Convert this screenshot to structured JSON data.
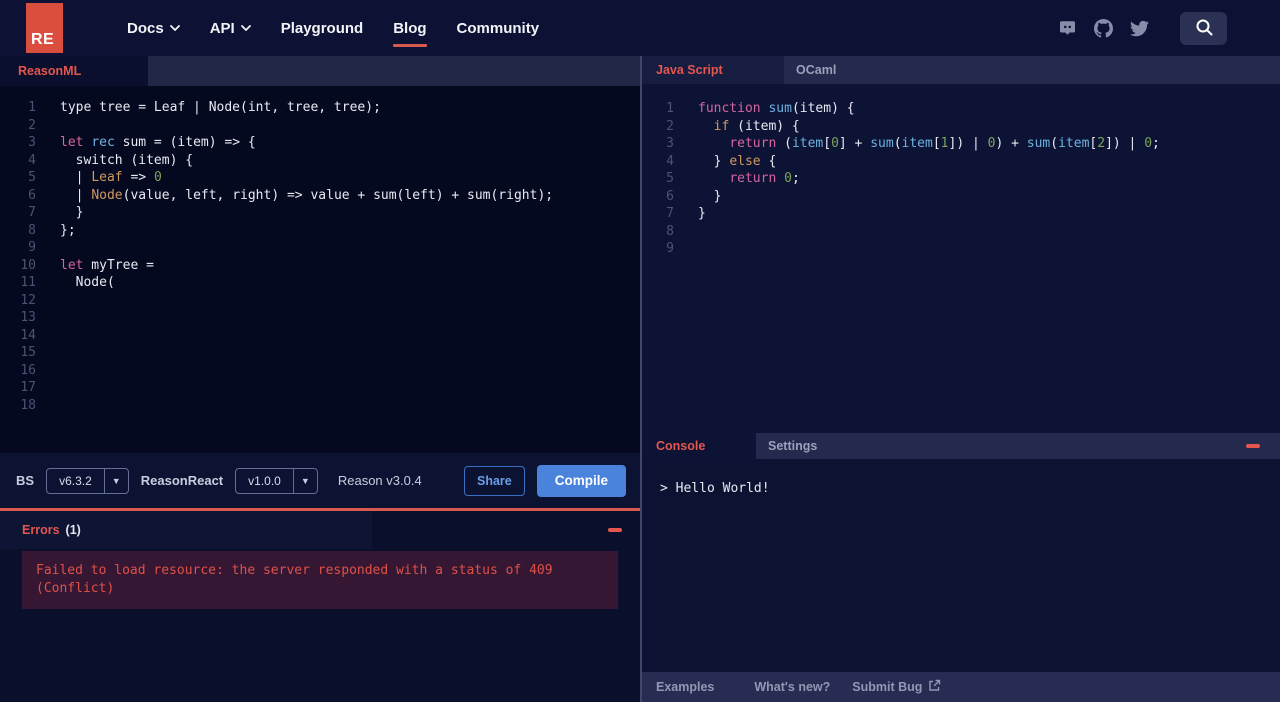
{
  "nav": {
    "logo": "RE",
    "items": [
      {
        "label": "Docs",
        "chevron": true,
        "active": false
      },
      {
        "label": "API",
        "chevron": true,
        "active": false
      },
      {
        "label": "Playground",
        "chevron": false,
        "active": false
      },
      {
        "label": "Blog",
        "chevron": false,
        "active": true
      },
      {
        "label": "Community",
        "chevron": false,
        "active": false
      }
    ]
  },
  "left_editor": {
    "tab_label": "ReasonML",
    "line_count": 18,
    "lines": [
      [
        [
          "p",
          "type tree = Leaf | Node(int, tree, tree);"
        ]
      ],
      [],
      [
        [
          "k",
          "let"
        ],
        [
          "p",
          " "
        ],
        [
          "b",
          "rec"
        ],
        [
          "p",
          " sum = (item) => {"
        ]
      ],
      [
        [
          "p",
          "  switch (item) {"
        ]
      ],
      [
        [
          "p",
          "  | "
        ],
        [
          "o",
          "Leaf"
        ],
        [
          "p",
          " => "
        ],
        [
          "g",
          "0"
        ]
      ],
      [
        [
          "p",
          "  | "
        ],
        [
          "o",
          "Node"
        ],
        [
          "p",
          "(value, left, right) => value + sum(left) + sum(right);"
        ]
      ],
      [
        [
          "p",
          "  }"
        ]
      ],
      [
        [
          "p",
          "};"
        ]
      ],
      [],
      [
        [
          "k",
          "let"
        ],
        [
          "p",
          " myTree ="
        ]
      ],
      [
        [
          "p",
          "  Node("
        ]
      ]
    ]
  },
  "right_editor": {
    "tabs": [
      "Java Script",
      "OCaml"
    ],
    "line_count": 9,
    "lines": [
      [
        [
          "k",
          "function"
        ],
        [
          "p",
          " "
        ],
        [
          "b",
          "sum"
        ],
        [
          "p",
          "(item) {"
        ]
      ],
      [
        [
          "p",
          "  "
        ],
        [
          "o",
          "if"
        ],
        [
          "p",
          " (item) {"
        ]
      ],
      [
        [
          "p",
          "    "
        ],
        [
          "k",
          "return"
        ],
        [
          "p",
          " ("
        ],
        [
          "b",
          "item"
        ],
        [
          "p",
          "["
        ],
        [
          "g",
          "0"
        ],
        [
          "p",
          "] + "
        ],
        [
          "b",
          "sum"
        ],
        [
          "p",
          "("
        ],
        [
          "b",
          "item"
        ],
        [
          "p",
          "["
        ],
        [
          "g",
          "1"
        ],
        [
          "p",
          "]) | "
        ],
        [
          "g",
          "0"
        ],
        [
          "p",
          ") + "
        ],
        [
          "b",
          "sum"
        ],
        [
          "p",
          "("
        ],
        [
          "b",
          "item"
        ],
        [
          "p",
          "["
        ],
        [
          "g",
          "2"
        ],
        [
          "p",
          "]) | "
        ],
        [
          "g",
          "0"
        ],
        [
          "p",
          ";"
        ]
      ],
      [
        [
          "p",
          "  } "
        ],
        [
          "o",
          "else"
        ],
        [
          "p",
          " {"
        ]
      ],
      [
        [
          "p",
          "    "
        ],
        [
          "k",
          "return"
        ],
        [
          "p",
          " "
        ],
        [
          "g",
          "0"
        ],
        [
          "p",
          ";"
        ]
      ],
      [
        [
          "p",
          "  }"
        ]
      ],
      [
        [
          "p",
          "}"
        ]
      ]
    ]
  },
  "toolbar": {
    "bs_label": "BS",
    "bs_version": "v6.3.2",
    "reasonreact_label": "ReasonReact",
    "reasonreact_version": "v1.0.0",
    "reason_version_text": "Reason v3.0.4",
    "share_label": "Share",
    "compile_label": "Compile"
  },
  "errors": {
    "title": "Errors",
    "count": "(1)",
    "message_line1": "Failed to load resource: the server responded with a status of 409",
    "message_line2": "(Conflict)"
  },
  "console": {
    "tabs": [
      "Console",
      "Settings"
    ],
    "output": "> Hello World!"
  },
  "footer": {
    "links": [
      "Examples",
      "What's new?",
      "Submit Bug"
    ]
  },
  "colors": {
    "brand_red": "#db4d3f",
    "accent_red": "#e4564e",
    "button_blue": "#4a83dc",
    "code_pink": "#d565a0",
    "code_blue": "#6cb2e2",
    "code_orange": "#cf9960",
    "code_green": "#7ba55c"
  }
}
